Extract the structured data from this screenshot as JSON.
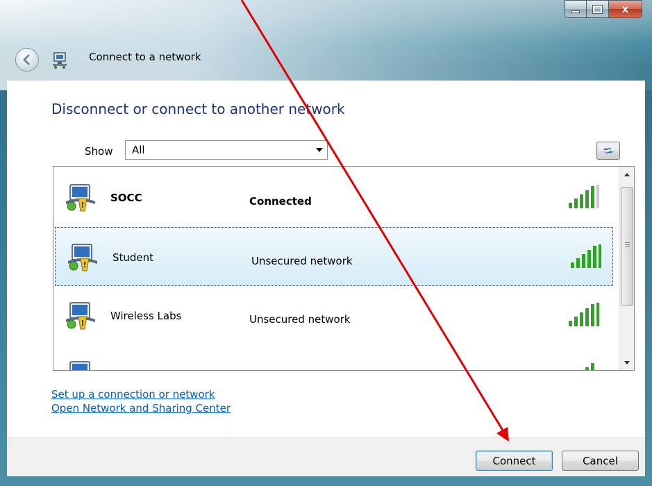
{
  "window": {
    "title": "Connect to a network",
    "controls": {
      "minimize": "minimize",
      "maximize": "maximize",
      "close": "x"
    }
  },
  "main": {
    "heading": "Disconnect or connect to another network",
    "show_label": "Show",
    "show_value": "All"
  },
  "networks": [
    {
      "name": "SOCC",
      "status": "Connected",
      "selected": false,
      "icon": "wireless-network-icon",
      "signal": "signal-full-icon"
    },
    {
      "name": "Student",
      "status": "Unsecured network",
      "selected": true,
      "icon": "wireless-network-icon",
      "signal": "signal-full-icon"
    },
    {
      "name": "Wireless Labs",
      "status": "Unsecured network",
      "selected": false,
      "icon": "wireless-network-icon",
      "signal": "signal-full-icon"
    }
  ],
  "links": {
    "setup": "Set up a connection or network",
    "sharing_center": "Open Network and Sharing Center"
  },
  "buttons": {
    "connect": "Connect",
    "cancel": "Cancel"
  },
  "colors": {
    "heading": "#1e3287",
    "link": "#0060bf",
    "annotation_arrow": "#e00000",
    "signal_green": "#2fa323"
  }
}
